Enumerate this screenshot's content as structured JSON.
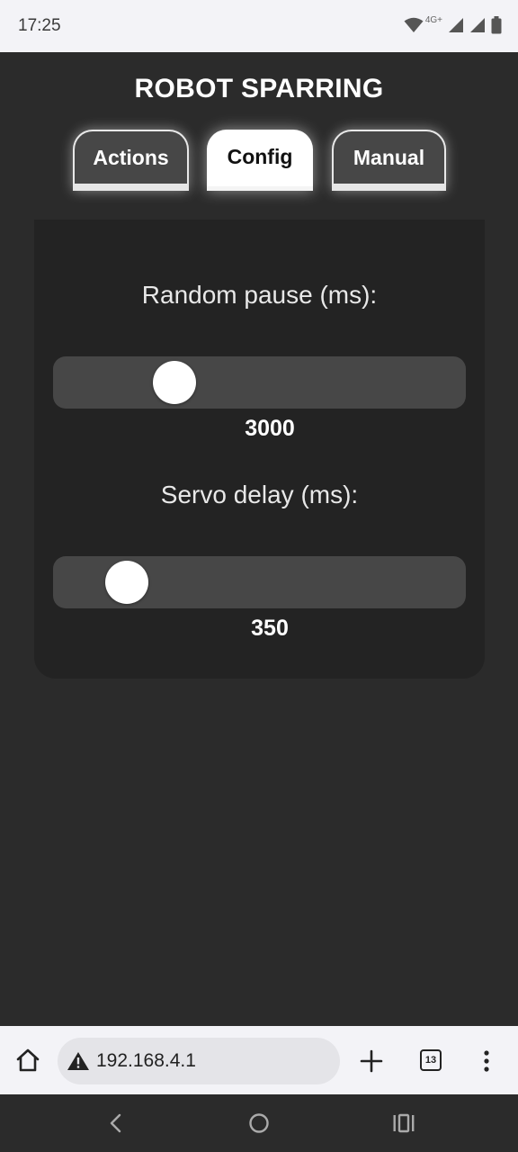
{
  "status_bar": {
    "time": "17:25",
    "network_label": "4G+",
    "icons": [
      "wifi-icon",
      "signal-icon",
      "signal-icon",
      "battery-icon"
    ]
  },
  "app": {
    "title": "ROBOT SPARRING",
    "tabs": [
      {
        "label": "Actions",
        "active": false
      },
      {
        "label": "Config",
        "active": true
      },
      {
        "label": "Manual",
        "active": false
      }
    ]
  },
  "config": {
    "random_pause": {
      "label": "Random pause (ms):",
      "value": "3000",
      "slider_fraction": 0.27
    },
    "servo_delay": {
      "label": "Servo delay (ms):",
      "value": "350",
      "slider_fraction": 0.14
    }
  },
  "browser": {
    "url": "192.168.4.1",
    "tab_count": "13",
    "icons": [
      "home-icon",
      "warning-icon",
      "plus-icon",
      "tabs-icon",
      "menu-icon"
    ]
  },
  "nav": {
    "icons": [
      "back-icon",
      "home-circle-icon",
      "recents-icon"
    ]
  },
  "colors": {
    "background": "#2b2b2b",
    "panel": "#232323",
    "track": "#474747",
    "accent": "#ffffff"
  }
}
